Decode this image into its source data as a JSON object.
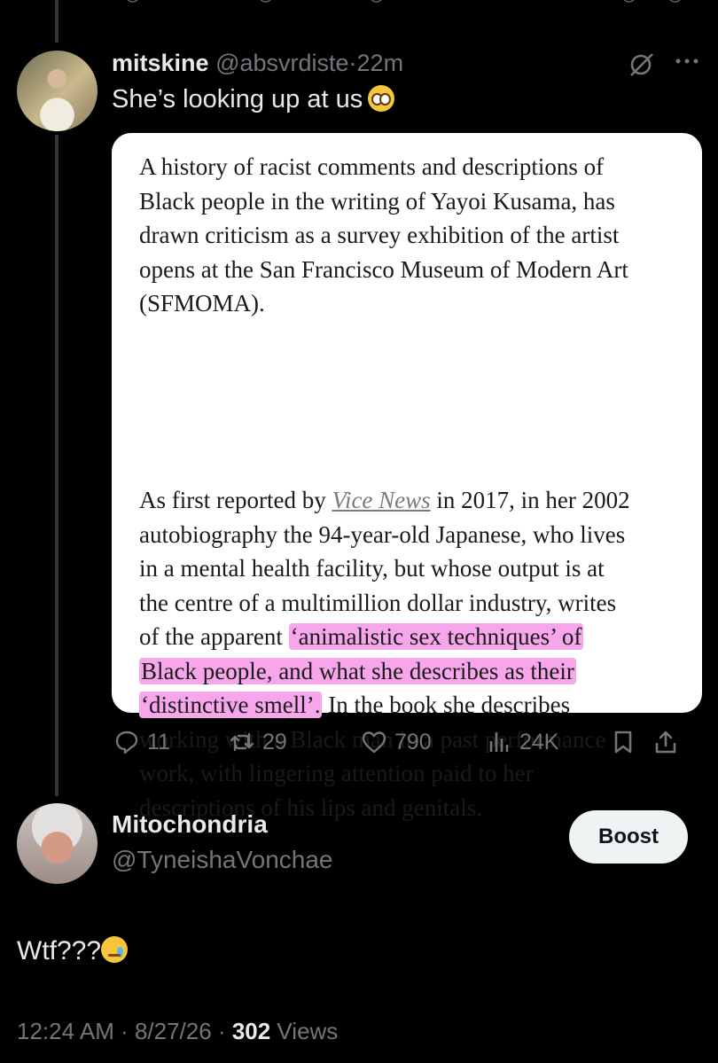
{
  "top_actions": [
    "reply-icon",
    "retweet-icon",
    "like-icon",
    "views-icon",
    "bookmark-icon",
    "share-icon"
  ],
  "tweet1": {
    "display_name": "mitskine",
    "handle": "@absvrdiste",
    "separator": "·",
    "time": "22m",
    "text": "She’s looking up at us",
    "emoji": "pleading-face-emoji",
    "card": {
      "para1_lines": [
        "A history of racist comments and descriptions of",
        "Black people in the writing of Yayoi Kusama, has",
        "drawn criticism as a survey exhibition of the artist",
        "opens at the San Francisco Museum of Modern Art",
        "(SFMOMA)."
      ],
      "p2_l1_a": "As first reported by ",
      "p2_l1_link": "Vice News",
      "p2_l1_b": " in 2017, in her 2002",
      "p2_l2": "autobiography the 94-year-old Japanese, who lives",
      "p2_l3": "in a mental health facility, but whose output is at",
      "p2_l4": "the centre of a multimillion dollar industry, writes",
      "p2_l5_a": "of the apparent ",
      "p2_l5_hl": "‘animalistic sex techniques’ of",
      "p2_l6_hl": "Black people, and what she describes as their",
      "p2_l7_hl": "‘distinctive smell’.",
      "p2_l7_b": " In the book she describes",
      "p2_l8": "working with a Black man in a past performance",
      "p2_l9": "work, with lingering attention paid to her",
      "p2_l10": "descriptions of his lips and genitals."
    },
    "actions": {
      "replies": "11",
      "reposts": "29",
      "likes": "790",
      "views": "24K"
    }
  },
  "tweet2": {
    "display_name": "Mitochondria",
    "handle": "@TyneishaVonchae",
    "boost_label": "Boost",
    "text": "Wtf???",
    "emoji": "sad-but-relieved-face-emoji",
    "timestamp": "12:24 AM · 8/27/26 · ",
    "views_count": "302",
    "views_label": " Views"
  },
  "colors": {
    "background": "#000000",
    "text": "#e7e9ea",
    "secondary": "#71767b",
    "highlight": "#f7a6ec",
    "card_bg": "#ffffff"
  }
}
